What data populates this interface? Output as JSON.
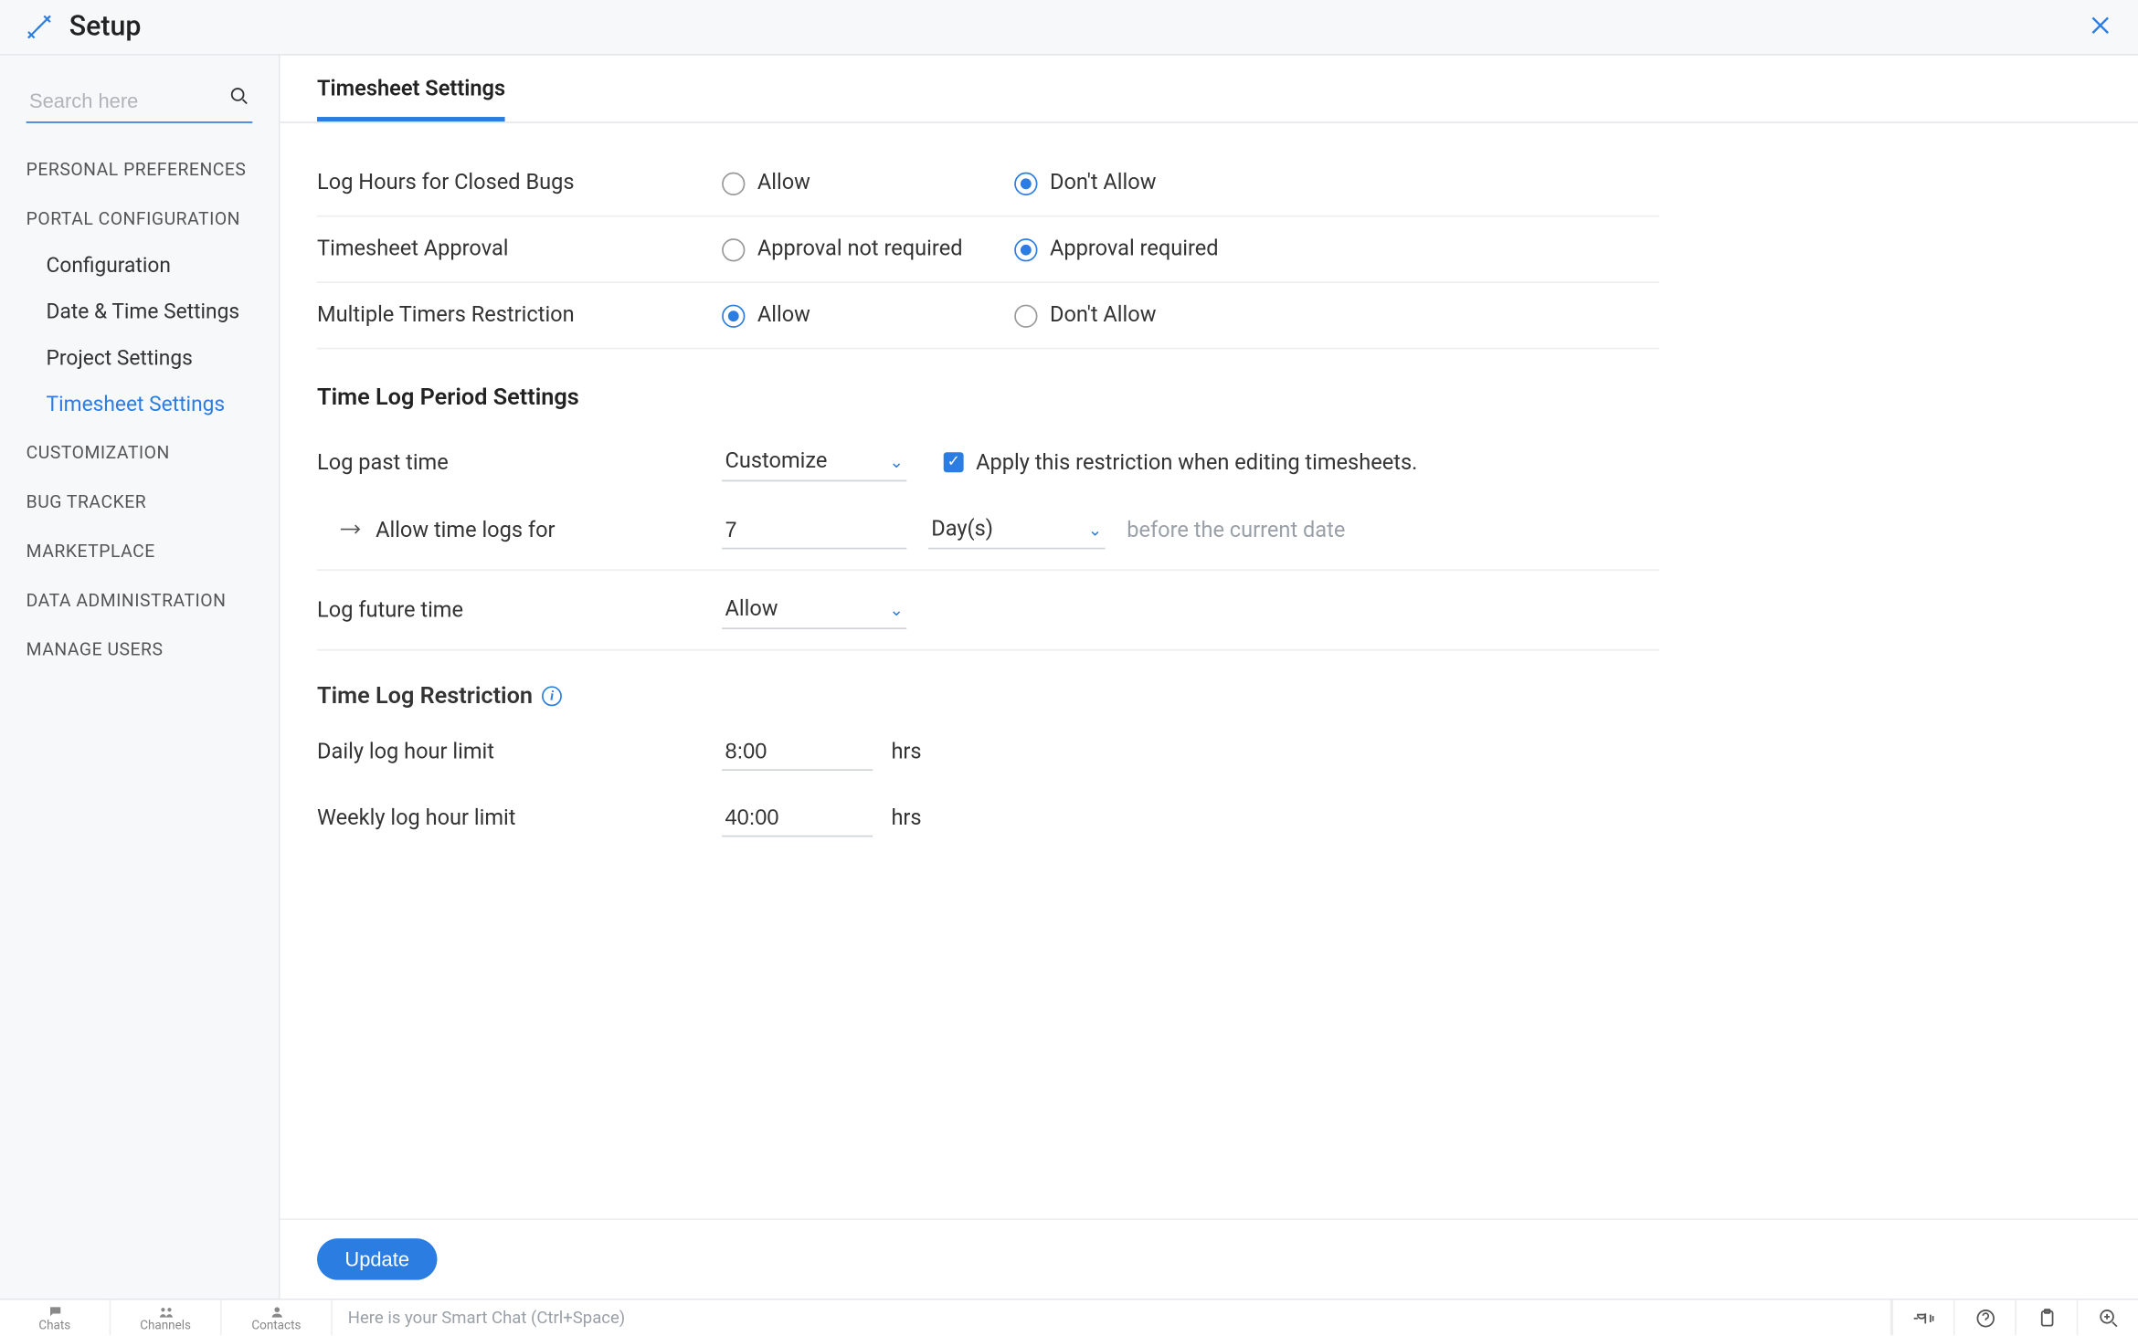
{
  "header": {
    "title": "Setup"
  },
  "sidebar": {
    "search_placeholder": "Search here",
    "sections": {
      "personal_preferences": "PERSONAL PREFERENCES",
      "portal_config": "PORTAL CONFIGURATION",
      "portal_items": {
        "configuration": "Configuration",
        "date_time": "Date & Time Settings",
        "project": "Project Settings",
        "timesheet": "Timesheet Settings"
      },
      "customization": "CUSTOMIZATION",
      "bug_tracker": "BUG TRACKER",
      "marketplace": "MARKETPLACE",
      "data_admin": "DATA ADMINISTRATION",
      "manage_users": "MANAGE USERS"
    }
  },
  "tab": {
    "label": "Timesheet Settings"
  },
  "rows": {
    "closed_bugs": {
      "label": "Log Hours for Closed Bugs",
      "opt1": "Allow",
      "opt2": "Don't Allow"
    },
    "approval": {
      "label": "Timesheet Approval",
      "opt1": "Approval not required",
      "opt2": "Approval required"
    },
    "timers": {
      "label": "Multiple Timers Restriction",
      "opt1": "Allow",
      "opt2": "Don't Allow"
    }
  },
  "period": {
    "heading": "Time Log Period Settings",
    "log_past_label": "Log past time",
    "log_past_dd": "Customize",
    "apply_restriction": "Apply this restriction when editing timesheets.",
    "allow_timelogs": "Allow time logs for",
    "days_value": "7",
    "days_unit": "Day(s)",
    "before_hint": "before the current date",
    "log_future_label": "Log future time",
    "log_future_dd": "Allow"
  },
  "restriction": {
    "heading": "Time Log Restriction",
    "daily_label": "Daily log hour limit",
    "daily_value": "8:00",
    "weekly_label": "Weekly log hour limit",
    "weekly_value": "40:00",
    "hrs": "hrs"
  },
  "buttons": {
    "update": "Update"
  },
  "bottombar": {
    "chats": "Chats",
    "channels": "Channels",
    "contacts": "Contacts",
    "smartchat_placeholder": "Here is your Smart Chat (Ctrl+Space)"
  }
}
